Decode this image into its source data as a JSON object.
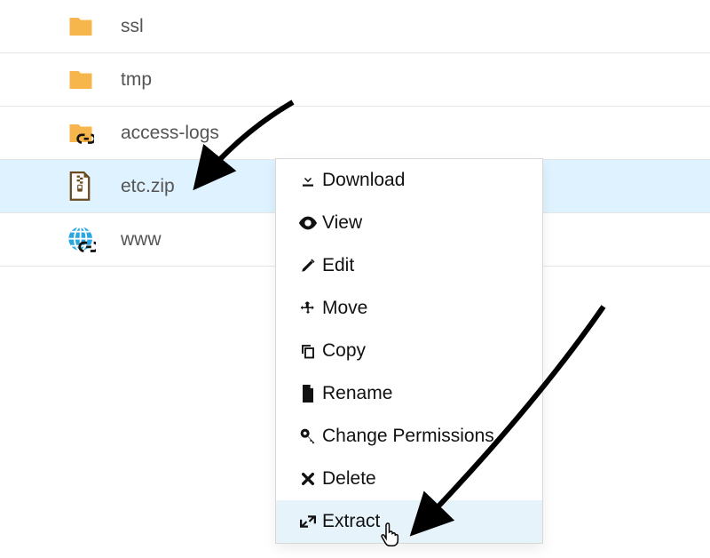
{
  "files": [
    {
      "name": "ssl",
      "icon": "folder",
      "selected": false
    },
    {
      "name": "tmp",
      "icon": "folder",
      "selected": false
    },
    {
      "name": "access-logs",
      "icon": "folder-link",
      "selected": false
    },
    {
      "name": "etc.zip",
      "icon": "zip-file",
      "selected": true
    },
    {
      "name": "www",
      "icon": "globe-link",
      "selected": false
    }
  ],
  "menu": [
    {
      "label": "Download",
      "icon": "download-icon"
    },
    {
      "label": "View",
      "icon": "eye-icon"
    },
    {
      "label": "Edit",
      "icon": "pencil-icon"
    },
    {
      "label": "Move",
      "icon": "move-icon"
    },
    {
      "label": "Copy",
      "icon": "copy-icon"
    },
    {
      "label": "Rename",
      "icon": "file-icon"
    },
    {
      "label": "Change Permissions",
      "icon": "key-icon"
    },
    {
      "label": "Delete",
      "icon": "x-icon"
    },
    {
      "label": "Extract",
      "icon": "expand-icon",
      "hover": true
    }
  ]
}
